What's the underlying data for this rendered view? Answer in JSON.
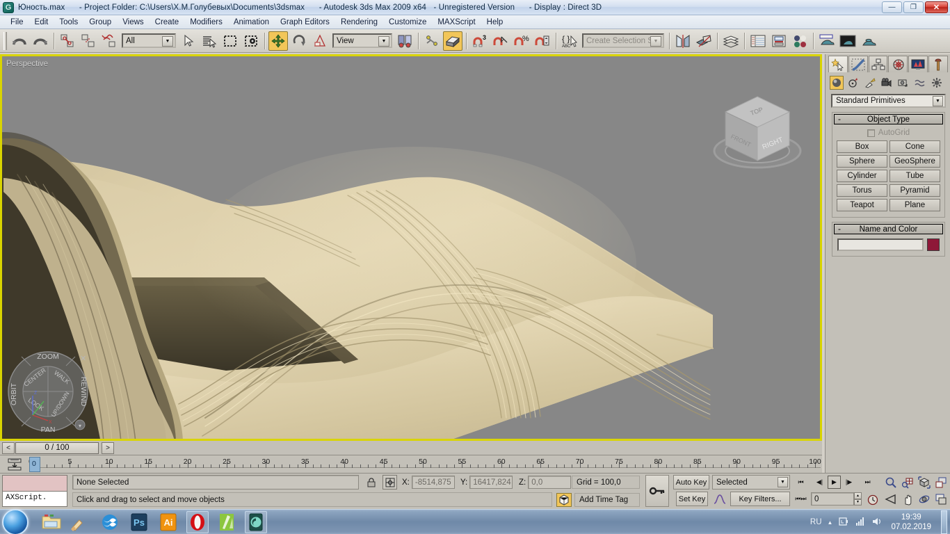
{
  "titlebar": {
    "app_icon": "3dsmax-icon",
    "file_name": "Юность.max",
    "project_folder": "- Project Folder: C:\\Users\\Х.М.Голубевых\\Documents\\3dsmax",
    "product": "- Autodesk 3ds Max  2009 x64",
    "license": "- Unregistered Version",
    "display": "- Display : Direct 3D",
    "minimize_label": "—",
    "restore_label": "❐",
    "close_label": "✕"
  },
  "menubar": {
    "items": [
      "File",
      "Edit",
      "Tools",
      "Group",
      "Views",
      "Create",
      "Modifiers",
      "Animation",
      "Graph Editors",
      "Rendering",
      "Customize",
      "MAXScript",
      "Help"
    ]
  },
  "toolbar": {
    "undo": "undo-icon",
    "redo": "redo-icon",
    "select_link": "select-and-link-icon",
    "unlink": "unlink-selection-icon",
    "bind_space_warp": "bind-to-space-warp-icon",
    "selection_filter_value": "All",
    "select_object": "select-object-icon",
    "select_by_name": "select-by-name-icon",
    "select_region_rect": "rectangular-selection-region-icon",
    "window_crossing": "window-crossing-icon",
    "select_move": "select-and-move-icon",
    "select_rotate": "select-and-rotate-icon",
    "select_scale": "select-and-uniform-scale-icon",
    "reference_coord_value": "View",
    "pivot": "use-pivot-point-center-icon",
    "mirror_snap": "snaps-toggle-icon",
    "named_selection_placeholder": "Create Selection Set",
    "snap_3": "snap-toggle-3-icon",
    "angle_snap": "angle-snap-toggle-icon",
    "percent_snap": "percent-snap-toggle-icon",
    "spinner_snap": "spinner-snap-toggle-icon",
    "edit_named_sets": "edit-named-selection-sets-icon",
    "mirror": "mirror-icon",
    "align": "align-icon",
    "layer_manager": "layer-manager-icon",
    "curve_editor": "curve-editor-icon",
    "schematic_view": "schematic-view-icon",
    "material_editor": "material-editor-icon",
    "render_setup": "render-setup-icon",
    "render_frame_window": "rendered-frame-window-icon",
    "render_production": "render-production-icon"
  },
  "viewport": {
    "label": "Perspective",
    "border_color": "#d9d400",
    "bg_color": "#878787",
    "model_name": "draped-cloth-surface",
    "model_color_light": "#e0d3ae",
    "model_color_mid": "#cbbc95",
    "model_color_dark": "#6f6448",
    "viewcube": {
      "name": "view-cube",
      "faces": {
        "top": "TOP",
        "front": "FRONT",
        "right": "RIGHT"
      }
    },
    "steering_wheel": {
      "name": "steering-wheel",
      "outer": [
        "ZOOM",
        "REWIND",
        "PAN",
        "ORBIT"
      ],
      "inner": [
        "CENTER",
        "WALK",
        "UP/DOWN",
        "LOOK"
      ],
      "close_label": "✕",
      "menu_label": "▾"
    }
  },
  "timeslider": {
    "prev_label": "<",
    "next_label": ">",
    "frame_text": "0 / 100"
  },
  "trackbar": {
    "key_mode_icon": "open-mini-curve-editor-icon",
    "ticks": [
      0,
      5,
      10,
      15,
      20,
      25,
      30,
      35,
      40,
      45,
      50,
      55,
      60,
      65,
      70,
      75,
      80,
      85,
      90,
      95,
      100
    ],
    "current_frame": "0"
  },
  "statusbar": {
    "maxscript_listener": "AXScript.",
    "selection_status": "None Selected",
    "lock_icon": "selection-lock-toggle-icon",
    "transform_type_icon": "absolute-relative-transform-toggle-icon",
    "x_label": "X:",
    "x_value": "-8514,875",
    "y_label": "Y:",
    "y_value": "16417,824",
    "z_label": "Z:",
    "z_value": "0,0",
    "grid_text": "Grid = 100,0",
    "prompt": "Click and drag to select and move objects",
    "add_time_tag": "Add Time Tag",
    "time_tag_icon": "time-tag-icon",
    "key_mode_toggle_icon": "key-mode-toggle-icon"
  },
  "animation": {
    "auto_key": "Auto Key",
    "set_key": "Set Key",
    "key_filter_set": "Selected",
    "key_filters": "Key Filters...",
    "curve_icon": "default-in-out-tangents-icon",
    "go_to_start": "⏮",
    "previous_frame": "◀|",
    "play": "▶",
    "next_frame": "|▶",
    "go_to_end": "⏭",
    "key_mode": "⏮⏭",
    "current_frame": "0"
  },
  "navigation": {
    "zoom": "zoom-icon",
    "zoom_all": "zoom-all-icon",
    "zoom_extents": "zoom-extents-icon",
    "zoom_region": "zoom-region-icon",
    "field_of_view": "field-of-view-icon",
    "pan": "pan-view-icon",
    "orbit": "orbit-icon",
    "maximize_viewport": "maximize-viewport-toggle-icon"
  },
  "cmdpanel": {
    "tabs": [
      {
        "name": "tab-create",
        "icon": "create-star-icon",
        "active": true
      },
      {
        "name": "tab-modify",
        "icon": "modify-curve-icon",
        "active": false
      },
      {
        "name": "tab-hierarchy",
        "icon": "hierarchy-icon",
        "active": false
      },
      {
        "name": "tab-motion",
        "icon": "motion-wheel-icon",
        "active": false
      },
      {
        "name": "tab-display",
        "icon": "display-monitor-icon",
        "active": false
      },
      {
        "name": "tab-utilities",
        "icon": "utilities-hammer-icon",
        "active": false
      }
    ],
    "subtabs": [
      {
        "name": "subtab-geometry",
        "icon": "geometry-sphere-icon",
        "active": true
      },
      {
        "name": "subtab-shapes",
        "icon": "shapes-icon",
        "active": false
      },
      {
        "name": "subtab-lights",
        "icon": "lights-icon",
        "active": false
      },
      {
        "name": "subtab-cameras",
        "icon": "cameras-icon",
        "active": false
      },
      {
        "name": "subtab-helpers",
        "icon": "helpers-icon",
        "active": false
      },
      {
        "name": "subtab-space-warps",
        "icon": "space-warps-icon",
        "active": false
      },
      {
        "name": "subtab-systems",
        "icon": "systems-gear-icon",
        "active": false
      }
    ],
    "category_value": "Standard Primitives",
    "object_type": {
      "header": "Object Type",
      "collapse": "-",
      "autogrid_label": "AutoGrid",
      "buttons": [
        "Box",
        "Cone",
        "Sphere",
        "GeoSphere",
        "Cylinder",
        "Tube",
        "Torus",
        "Pyramid",
        "Teapot",
        "Plane"
      ]
    },
    "name_and_color": {
      "header": "Name and Color",
      "collapse": "-",
      "name_value": "",
      "color": "#8e1838"
    }
  },
  "taskbar": {
    "start": "start-orb-icon",
    "apps": [
      {
        "name": "explorer-icon",
        "label": ""
      },
      {
        "name": "ccleaner-icon",
        "label": ""
      },
      {
        "name": "openoffice-icon",
        "label": ""
      },
      {
        "name": "photoshop-icon",
        "label": "Ps"
      },
      {
        "name": "illustrator-icon",
        "label": "Ai"
      },
      {
        "name": "opera-icon",
        "label": "O"
      },
      {
        "name": "corel-icon",
        "label": ""
      },
      {
        "name": "3dsmax-taskbar-icon",
        "label": ""
      }
    ],
    "tray": {
      "language": "RU",
      "show_hidden": "▲",
      "battery_icon": "battery-icon",
      "network_icon": "network-signal-icon",
      "volume_icon": "volume-icon",
      "time": "19:39",
      "date": "07.02.2019"
    }
  }
}
